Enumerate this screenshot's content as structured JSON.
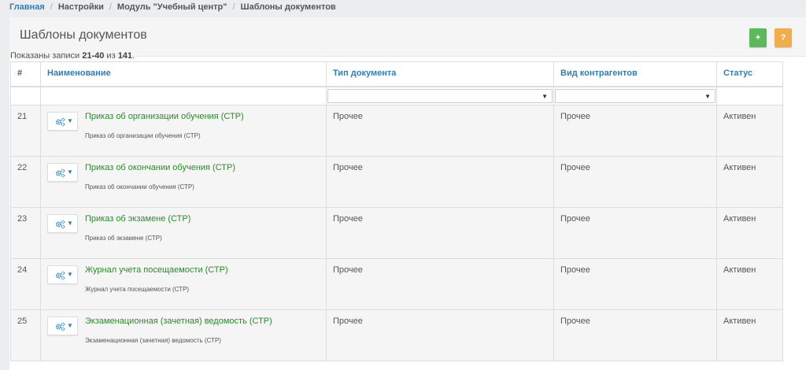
{
  "breadcrumb": {
    "home": "Главная",
    "items": [
      "Настройки",
      "Модуль \"Учебный центр\"",
      "Шаблоны документов"
    ]
  },
  "page": {
    "title": "Шаблоны документов",
    "add_label": "+",
    "help_label": "?"
  },
  "summary": {
    "prefix": "Показаны записи ",
    "range": "21-40",
    "of": " из ",
    "total": "141",
    "suffix": "."
  },
  "table": {
    "columns": [
      "#",
      "Наименование",
      "Тип документа",
      "Вид контрагентов",
      "Статус"
    ],
    "rows": [
      {
        "num": "21",
        "name": "Приказ об организации обучения (СТР)",
        "subtitle": "Приказ об организации обучения (СТР)",
        "doc_type": "Прочее",
        "counterparty": "Прочее",
        "status": "Активен"
      },
      {
        "num": "22",
        "name": "Приказ об окончании обучения (СТР)",
        "subtitle": "Приказ об окончании обучения (СТР)",
        "doc_type": "Прочее",
        "counterparty": "Прочее",
        "status": "Активен"
      },
      {
        "num": "23",
        "name": "Приказ об экзамене (СТР)",
        "subtitle": "Приказ об экзамене (СТР)",
        "doc_type": "Прочее",
        "counterparty": "Прочее",
        "status": "Активен"
      },
      {
        "num": "24",
        "name": "Журнал учета посещаемости (СТР)",
        "subtitle": "Журнал учета посещаемости (СТР)",
        "doc_type": "Прочее",
        "counterparty": "Прочее",
        "status": "Активен"
      },
      {
        "num": "25",
        "name": "Экзаменационная (зачетная) ведомость (СТР)",
        "subtitle": "Экзаменационная (зачетная) ведомость (СТР)",
        "doc_type": "Прочее",
        "counterparty": "Прочее",
        "status": "Активен"
      }
    ]
  },
  "icons": {
    "row_actions": "gears-icon",
    "caret": "caret-down-icon"
  },
  "colors": {
    "link": "#2e7fb8",
    "name_link": "#2a8a2a",
    "add_button": "#5cb85c",
    "help_button": "#f0ad4e"
  }
}
